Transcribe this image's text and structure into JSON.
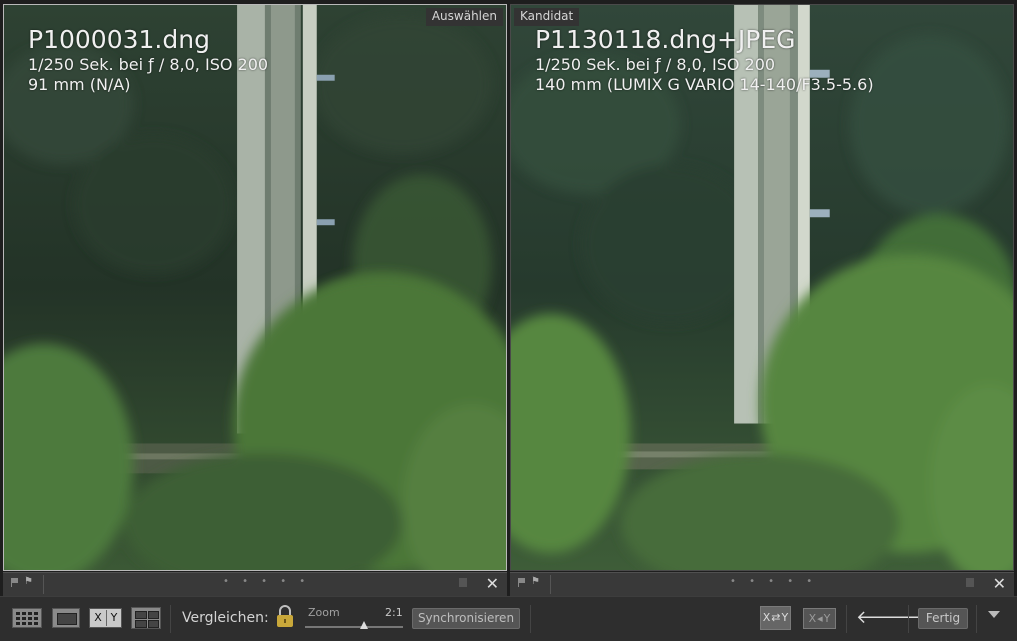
{
  "left_pane": {
    "badge": "Auswählen",
    "filename": "P1000031.dng",
    "exposure": "1/250 Sek. bei ƒ / 8,0, ISO 200",
    "lens": "91 mm (N/A)"
  },
  "right_pane": {
    "badge": "Kandidat",
    "filename": "P1130118.dng+JPEG",
    "exposure": "1/250 Sek. bei ƒ / 8,0, ISO 200",
    "lens": "140 mm (LUMIX G VARIO 14-140/F3.5-5.6)"
  },
  "subbar": {
    "dots": "• • • • •",
    "close": "✕"
  },
  "toolbar": {
    "compare_label": "Vergleichen:",
    "zoom_label": "Zoom",
    "zoom_value": "2:1",
    "zoom_level_fraction": 0.6,
    "sync_label": "Synchronisieren",
    "done_label": "Fertig",
    "xy_x": "X",
    "xy_y": "Y",
    "left_arrow": "🡐",
    "right_arrow": "🡒"
  },
  "icons": {
    "grid": "grid-view-icon",
    "loupe": "loupe-view-icon",
    "compare": "compare-view-icon",
    "survey": "survey-view-icon",
    "lock": "lock-icon",
    "swap": "swap-icon",
    "make_select": "make-select-icon",
    "menu": "chevron-down-icon"
  },
  "colors": {
    "foliage_dark": "#26382a",
    "foliage_light": "#4e7a3c",
    "tower": "#b9c2b4"
  }
}
